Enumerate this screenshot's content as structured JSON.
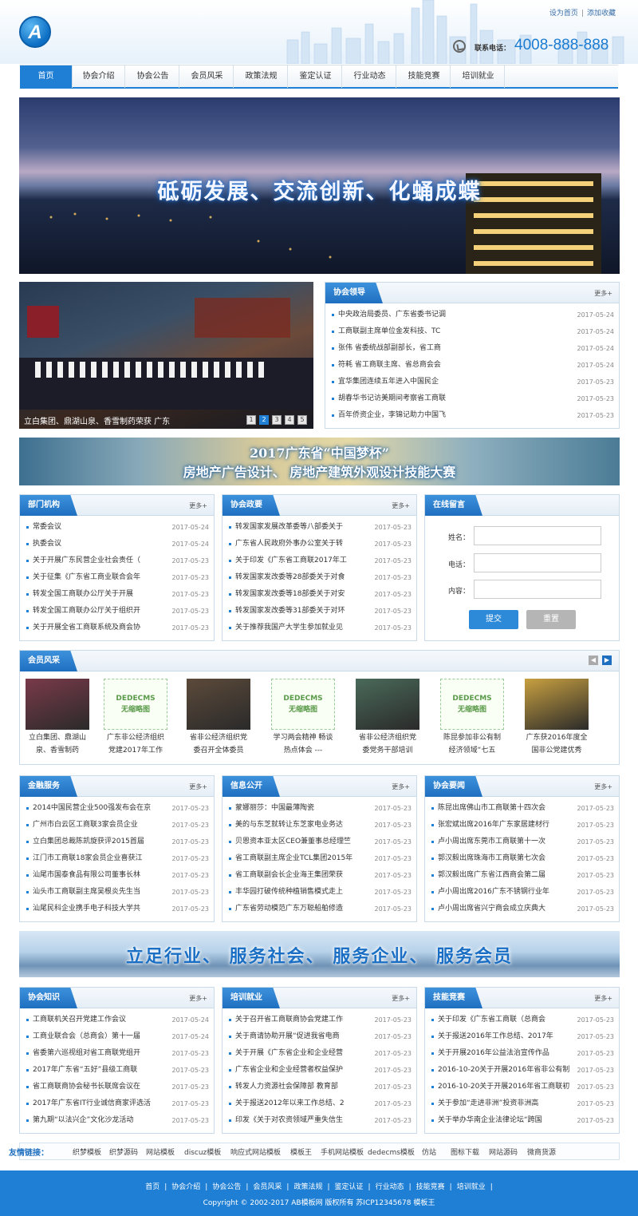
{
  "header": {
    "logo_letter": "A",
    "top_links": [
      "设为首页",
      "添加收藏"
    ],
    "phone_label": "联系电话：",
    "phone_number": "4008-888-888"
  },
  "nav": [
    "首页",
    "协会介绍",
    "协会公告",
    "会员风采",
    "政策法规",
    "鉴定认证",
    "行业动态",
    "技能竞赛",
    "培训就业"
  ],
  "banner_text": "砥砺发展、交流创新、化蛹成蝶",
  "slider": {
    "caption": "立白集团、鼎湖山泉、香雪制药荣获 广东",
    "pages": [
      "1",
      "2",
      "3",
      "4",
      "5"
    ],
    "active_page": 2
  },
  "more_label": "更多+",
  "leaders": {
    "title": "协会领导",
    "items": [
      {
        "t": "中央政治局委员、广东省委书记调",
        "d": "2017-05-24"
      },
      {
        "t": "工商联副主席单位金发科技、TC",
        "d": "2017-05-24"
      },
      {
        "t": "张伟 省委统战部副部长，省工商",
        "d": "2017-05-24"
      },
      {
        "t": "符耗 省工商联主席、省总商会会",
        "d": "2017-05-24"
      },
      {
        "t": "宜华集团连续五年进入中国民企",
        "d": "2017-05-23"
      },
      {
        "t": "胡春华书记访美期间考察省工商联",
        "d": "2017-05-23"
      },
      {
        "t": "百年侨资企业，李锦记助力中国飞",
        "d": "2017-05-23"
      }
    ]
  },
  "ad1": {
    "line1": "2017广东省“中国梦杯”",
    "line2": "房地产广告设计、 房地产建筑外观设计技能大赛"
  },
  "departments": {
    "title": "部门机构",
    "items": [
      {
        "t": "常委会议",
        "d": "2017-05-24"
      },
      {
        "t": "执委会议",
        "d": "2017-05-24"
      },
      {
        "t": "关于开展广东民营企业社会责任（",
        "d": "2017-05-23"
      },
      {
        "t": "关于征集《广东省工商业联合会年",
        "d": "2017-05-23"
      },
      {
        "t": "转发全国工商联办公厅关于开展",
        "d": "2017-05-23"
      },
      {
        "t": "转发全国工商联办公厅关于组织开",
        "d": "2017-05-23"
      },
      {
        "t": "关于开展全省工商联系统及商会协",
        "d": "2017-05-23"
      }
    ]
  },
  "politics": {
    "title": "协会政要",
    "items": [
      {
        "t": "转发国家发展改革委等八部委关于",
        "d": "2017-05-23"
      },
      {
        "t": "广东省人民政府外事办公室关于转",
        "d": "2017-05-23"
      },
      {
        "t": "关于印发《广东省工商联2017年工",
        "d": "2017-05-23"
      },
      {
        "t": "转发国家发改委等28部委关于对食",
        "d": "2017-05-23"
      },
      {
        "t": "转发国家发改委等18部委关于对安",
        "d": "2017-05-23"
      },
      {
        "t": "转发国家发改委等31部委关于对环",
        "d": "2017-05-23"
      },
      {
        "t": "关于推荐我国产大学生参加就业见",
        "d": "2017-05-23"
      }
    ]
  },
  "message": {
    "title": "在线留言",
    "name_label": "姓名：",
    "phone_label": "电话：",
    "content_label": "内容：",
    "submit": "提交",
    "reset": "重置"
  },
  "members": {
    "title": "会员风采",
    "placeholder_line1": "DEDECMS",
    "placeholder_line2": "无缩略图",
    "items": [
      {
        "cap": "立白集团、鼎湖山泉、香雪制药",
        "ph": false,
        "color": "#7a3a4a"
      },
      {
        "cap": "广东非公经济组织党建2017年工作",
        "ph": true
      },
      {
        "cap": "省非公经济组织党委召开全体委员",
        "ph": false,
        "color": "#5c4a3a"
      },
      {
        "cap": "学习两会精神 畅谈热点体会 ---",
        "ph": true
      },
      {
        "cap": "省非公经济组织党委党务干部培训",
        "ph": false,
        "color": "#4a6a5a"
      },
      {
        "cap": "陈昆参加非公有制经济领域“七五",
        "ph": true
      },
      {
        "cap": "广东获2016年度全国非公党建优秀",
        "ph": false,
        "color": "#c8a040"
      }
    ]
  },
  "finance": {
    "title": "金融服务",
    "items": [
      {
        "t": "2014中国民营企业500强发布会在京",
        "d": "2017-05-23"
      },
      {
        "t": "广州市白云区工商联3家会员企业",
        "d": "2017-05-23"
      },
      {
        "t": "立白集团总裁陈凯旋获评2015首届",
        "d": "2017-05-23"
      },
      {
        "t": "江门市工商联18家会员企业喜获江",
        "d": "2017-05-23"
      },
      {
        "t": "汕尾市国泰食品有限公司董事长林",
        "d": "2017-05-23"
      },
      {
        "t": "汕头市工商联副主席吴根炎先生当",
        "d": "2017-05-23"
      },
      {
        "t": "汕尾民科企业携手电子科技大学共",
        "d": "2017-05-23"
      }
    ]
  },
  "info": {
    "title": "信息公开",
    "items": [
      {
        "t": "蒙娜丽莎：中国最薄陶瓷",
        "d": "2017-05-23"
      },
      {
        "t": "美的与东芝就转让东芝家电业务达",
        "d": "2017-05-23"
      },
      {
        "t": "贝恩资本亚太区CEO兼董事总经理竺",
        "d": "2017-05-23"
      },
      {
        "t": "省工商联副主席企业TCL集团2015年",
        "d": "2017-05-23"
      },
      {
        "t": "省工商联副会长企业海王集团荣获",
        "d": "2017-05-23"
      },
      {
        "t": "丰华园打破传统种植销售模式走上",
        "d": "2017-05-23"
      },
      {
        "t": "广东省劳动模范广东万聪船舶修造",
        "d": "2017-05-23"
      }
    ]
  },
  "news": {
    "title": "协会要闻",
    "items": [
      {
        "t": "陈昆出席佛山市工商联第十四次会",
        "d": "2017-05-23"
      },
      {
        "t": "张宏斌出席2016年广东家居建材行",
        "d": "2017-05-23"
      },
      {
        "t": "卢小周出席东莞市工商联第十一次",
        "d": "2017-05-23"
      },
      {
        "t": "郭汉毅出席珠海市工商联第七次会",
        "d": "2017-05-23"
      },
      {
        "t": "郭汉毅出席广东省江西商会第二届",
        "d": "2017-05-23"
      },
      {
        "t": "卢小周出席2016广东不锈钢行业年",
        "d": "2017-05-23"
      },
      {
        "t": "卢小周出席省兴宁商会成立庆典大",
        "d": "2017-05-23"
      }
    ]
  },
  "ad2_text": "立足行业、 服务社会、 服务企业、 服务会员",
  "knowledge": {
    "title": "协会知识",
    "items": [
      {
        "t": "工商联机关召开党建工作会议",
        "d": "2017-05-24"
      },
      {
        "t": "工商业联合会（总商会）第十一届",
        "d": "2017-05-24"
      },
      {
        "t": "省委第六巡视组对省工商联党组开",
        "d": "2017-05-23"
      },
      {
        "t": "2017年广东省“五好”县级工商联",
        "d": "2017-05-23"
      },
      {
        "t": "省工商联商协会秘书长联席会议在",
        "d": "2017-05-23"
      },
      {
        "t": "2017年广东省IT行业诚信商家评选活",
        "d": "2017-05-23"
      },
      {
        "t": "第九期“以法兴企”文化沙龙活动",
        "d": "2017-05-23"
      }
    ]
  },
  "training": {
    "title": "培训就业",
    "items": [
      {
        "t": "关于召开省工商联商协会党建工作",
        "d": "2017-05-23"
      },
      {
        "t": "关于商请协助开展“促进我省电商",
        "d": "2017-05-23"
      },
      {
        "t": "关于开展《广东省企业和企业经营",
        "d": "2017-05-23"
      },
      {
        "t": "广东省企业和企业经营者权益保护",
        "d": "2017-05-23"
      },
      {
        "t": "转发人力资源社会保障部 教育部",
        "d": "2017-05-23"
      },
      {
        "t": "关于报送2012年以来工作总结、2",
        "d": "2017-05-23"
      },
      {
        "t": "印发《关于对农资领域严重失信生",
        "d": "2017-05-23"
      }
    ]
  },
  "skills": {
    "title": "技能竞赛",
    "items": [
      {
        "t": "关于印发《广东省工商联（总商会",
        "d": "2017-05-23"
      },
      {
        "t": "关于报送2016年工作总结、2017年",
        "d": "2017-05-23"
      },
      {
        "t": "关于开展2016年公益法治宣传作品",
        "d": "2017-05-23"
      },
      {
        "t": "2016-10-20关于开展2016年省非公有制",
        "d": "2017-05-23"
      },
      {
        "t": "2016-10-20关于开展2016年省工商联初",
        "d": "2017-05-23"
      },
      {
        "t": "关于参加“走进非洲”投资非洲高",
        "d": "2017-05-23"
      },
      {
        "t": "关于举办华南企业法律论坛“跨国",
        "d": "2017-05-23"
      }
    ]
  },
  "links": {
    "label": "友情链接：",
    "items": [
      "织梦模板",
      "织梦源码",
      "网站模板",
      "discuz模板",
      "响应式网站模板",
      "模板王",
      "手机网站模板",
      "dedecms模板",
      "仿站",
      "图标下载",
      "网站源码",
      "微商货源"
    ]
  },
  "footer": {
    "nav": [
      "首页",
      "协会介绍",
      "协会公告",
      "会员风采",
      "政策法规",
      "鉴定认证",
      "行业动态",
      "技能竞赛",
      "培训就业"
    ],
    "copyright": "Copyright © 2002-2017 AB模板网 版权所有 苏ICP12345678  模板王"
  },
  "colors": {
    "primary": "#1f7fd4",
    "dark_blue": "#1f6fc0",
    "footer": "#1f7fd4"
  }
}
